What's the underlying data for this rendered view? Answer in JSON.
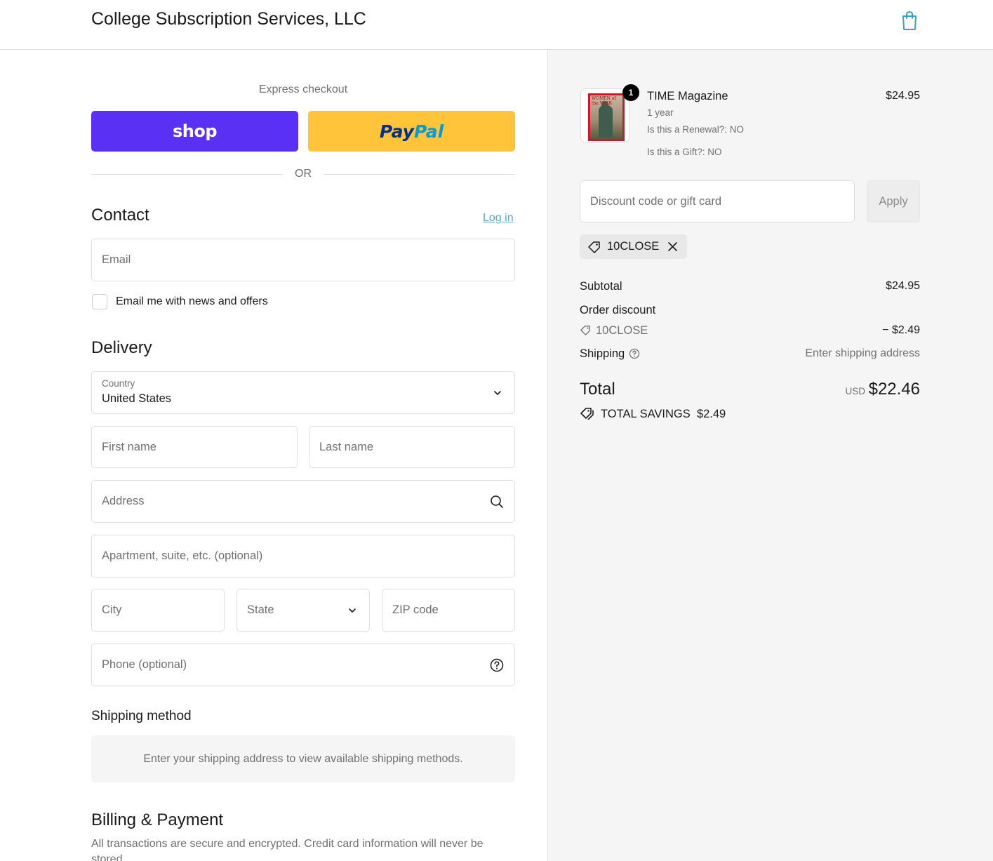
{
  "header": {
    "store_name": "College Subscription Services, LLC",
    "cart_icon": "shopping-bag-icon"
  },
  "express": {
    "label": "Express checkout",
    "shop_label": "shop",
    "paypal_pay": "Pay",
    "paypal_pal": "Pal",
    "or_label": "OR"
  },
  "contact": {
    "title": "Contact",
    "login_label": "Log in",
    "email_placeholder": "Email",
    "newsletter_label": "Email me with news and offers",
    "newsletter_checked": false
  },
  "delivery": {
    "title": "Delivery",
    "country_label": "Country",
    "country_value": "United States",
    "first_name_placeholder": "First name",
    "last_name_placeholder": "Last name",
    "address_placeholder": "Address",
    "apartment_placeholder": "Apartment, suite, etc. (optional)",
    "city_placeholder": "City",
    "state_placeholder": "State",
    "zip_placeholder": "ZIP code",
    "phone_placeholder": "Phone (optional)"
  },
  "shipping_method": {
    "title": "Shipping method",
    "message": "Enter your shipping address to view available shipping methods."
  },
  "billing": {
    "title": "Billing & Payment",
    "description": "All transactions are secure and encrypted. Credit card information will never be stored."
  },
  "order": {
    "item": {
      "name": "TIME Magazine",
      "quantity": "1",
      "term": "1 year",
      "renewal": "Is this a Renewal?: NO",
      "gift": "Is this a Gift?: NO",
      "price": "$24.95",
      "cover_text": "WOMEN of the YEAR"
    },
    "discount_placeholder": "Discount code or gift card",
    "apply_label": "Apply",
    "applied_code": "10CLOSE",
    "subtotal_label": "Subtotal",
    "subtotal_value": "$24.95",
    "order_discount_label": "Order discount",
    "discount_code": "10CLOSE",
    "discount_value": "− $2.49",
    "shipping_label": "Shipping",
    "shipping_value": "Enter shipping address",
    "total_label": "Total",
    "total_currency": "USD",
    "total_value": "$22.46",
    "savings_label": "TOTAL SAVINGS",
    "savings_value": "$2.49"
  },
  "colors": {
    "shop_purple": "#5a31f4",
    "paypal_yellow": "#ffc439",
    "link_blue": "#5aa9c8",
    "sidebar_bg": "#f5f5f5"
  }
}
